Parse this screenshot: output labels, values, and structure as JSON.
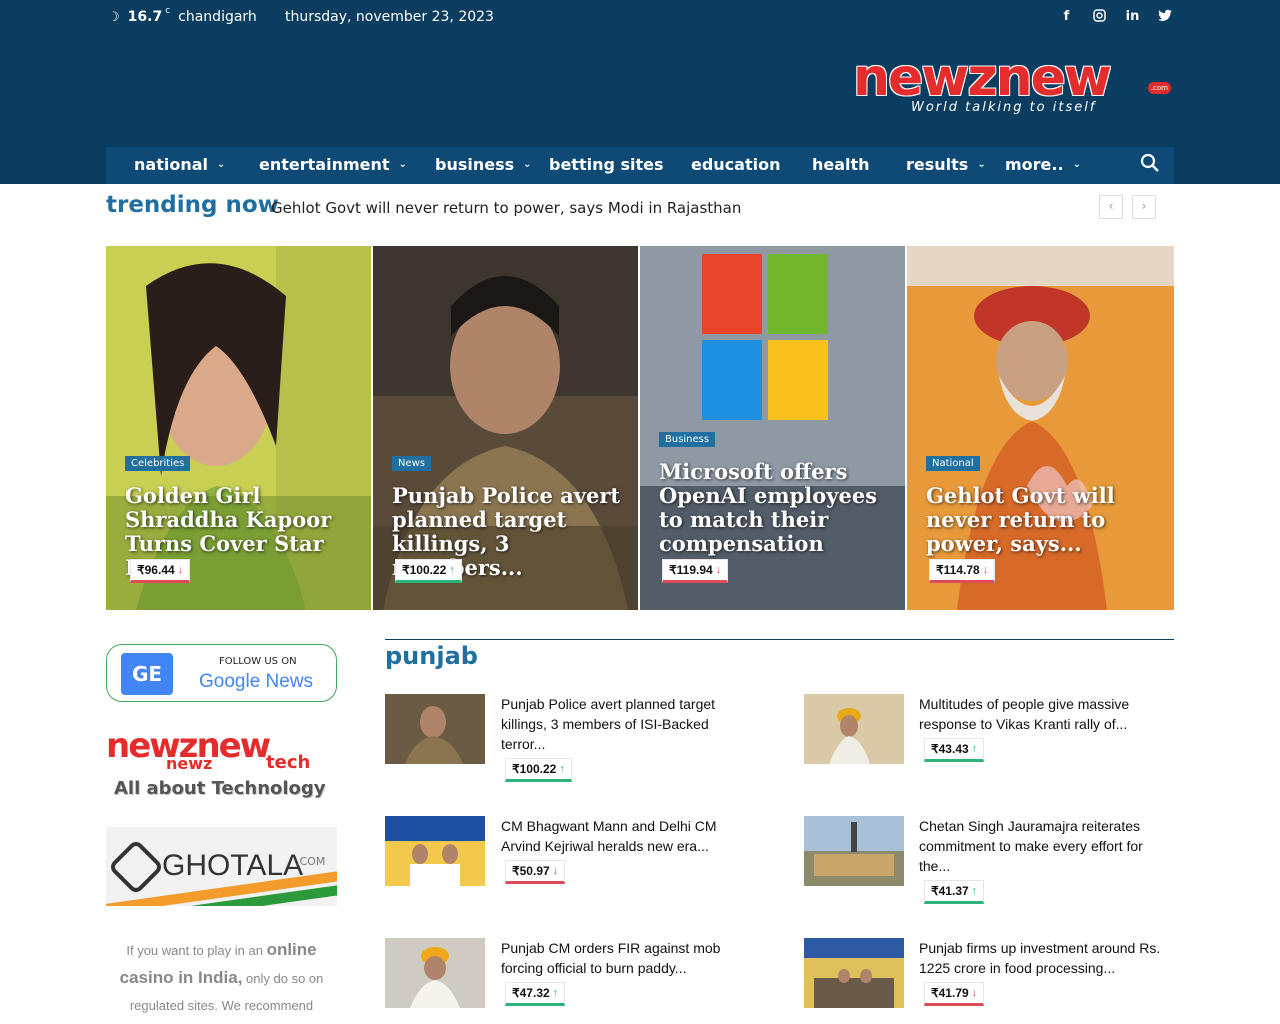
{
  "topbar": {
    "temperature": "16.7",
    "temp_unit": "c",
    "city": "chandigarh",
    "date": "thursday, november 23, 2023",
    "social": [
      "f",
      "ig",
      "in",
      "tw"
    ]
  },
  "logo": {
    "brand": "newznew",
    "tagline": "World talking to itself",
    "suffix": ".com"
  },
  "nav": {
    "items": [
      {
        "label": "national",
        "dropdown": true
      },
      {
        "label": "entertainment",
        "dropdown": true
      },
      {
        "label": "business",
        "dropdown": true
      },
      {
        "label": "betting sites",
        "dropdown": false
      },
      {
        "label": "education",
        "dropdown": false
      },
      {
        "label": "health",
        "dropdown": false
      },
      {
        "label": "results",
        "dropdown": true
      },
      {
        "label": "more..",
        "dropdown": true
      }
    ]
  },
  "trending": {
    "label": "trending now",
    "headline": "Gehlot Govt will never return to power, says Modi in Rajasthan"
  },
  "hero": [
    {
      "category": "Celebrities",
      "title": "Golden Girl Shraddha Kapoor Turns Cover Star For...",
      "price": "₹96.44",
      "trend": "down"
    },
    {
      "category": "News",
      "title": "Punjab Police avert planned target killings, 3 members...",
      "price": "₹100.22",
      "trend": "up"
    },
    {
      "category": "Business",
      "title": "Microsoft offers OpenAI employees to match their compensation",
      "price": "₹119.94",
      "trend": "down"
    },
    {
      "category": "National",
      "title": "Gehlot Govt will never return to power, says...",
      "price": "₹114.78",
      "trend": "down"
    }
  ],
  "sidebar": {
    "google_follow": "FOLLOW US ON",
    "google_news": "Google News",
    "tech_brand": "newznew",
    "tech_sub1": "newz",
    "tech_sub2": "tech",
    "tech_about": "All about Technology",
    "ghotala": "GHOTALA",
    "ghotala_com": ".COM",
    "casino_pre": "If you want to play in an ",
    "casino_link": "online casino in India,",
    "casino_post": " only do so on regulated sites. We recommend"
  },
  "section": {
    "title": "punjab",
    "articles": [
      {
        "title": "Punjab Police avert planned target killings, 3 members of ISI-Backed terror...",
        "price": "₹100.22",
        "trend": "up"
      },
      {
        "title": "Multitudes of people give massive response to Vikas Kranti rally of...",
        "price": "₹43.43",
        "trend": "up"
      },
      {
        "title": "CM Bhagwant Mann and Delhi CM Arvind Kejriwal heralds new era...",
        "price": "₹50.97",
        "trend": "down"
      },
      {
        "title": "Chetan Singh Jauramajra reiterates commitment to make every effort for the...",
        "price": "₹41.37",
        "trend": "up"
      },
      {
        "title": "Punjab CM orders FIR against mob forcing official to burn paddy...",
        "price": "₹47.32",
        "trend": "up"
      },
      {
        "title": "Punjab firms up investment around Rs. 1225 crore in food processing...",
        "price": "₹41.79",
        "trend": "down"
      }
    ]
  },
  "colors": {
    "navy": "#0b3d61",
    "accent": "#1f6fa1",
    "brand_red": "#e52c2c",
    "up": "#2db37a",
    "down": "#e04b5a"
  }
}
